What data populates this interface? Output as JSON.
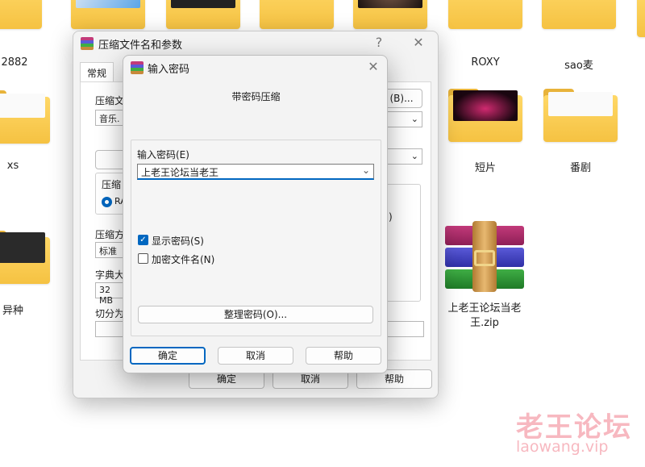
{
  "desktop": {
    "top_labels": [
      "2882",
      "ROXY",
      "sao麦"
    ],
    "middle_labels": [
      "xs",
      "短片",
      "番剧"
    ],
    "bottom_labels": [
      "异种"
    ],
    "zip_file_label": "上老王论坛当老王.zip"
  },
  "back_dialog": {
    "title": "压缩文件名和参数",
    "help_glyph": "?",
    "close_glyph": "✕",
    "tab_general": "常规",
    "archive_name_label": "压缩文",
    "archive_name_value": "音乐.",
    "browse_button": "(B)...",
    "format_label": "压缩",
    "format_option": "RA",
    "method_label": "压缩方",
    "method_value": "标准",
    "dict_label": "字典大",
    "dict_value": "32 MB",
    "split_label": "切分为",
    "right_paren": ")",
    "ok_button": "确定",
    "cancel_button": "取消",
    "help_button": "帮助"
  },
  "password_dialog": {
    "title": "输入密码",
    "close_glyph": "✕",
    "heading": "带密码压缩",
    "password_label": "输入密码(E)",
    "password_value": "上老王论坛当老王",
    "show_password_label": "显示密码(S)",
    "show_password_checked": true,
    "encrypt_names_label": "加密文件名(N)",
    "encrypt_names_checked": false,
    "organize_button": "整理密码(O)...",
    "ok_button": "确定",
    "cancel_button": "取消",
    "help_button": "帮助"
  },
  "watermark": {
    "text": "老王论坛",
    "url": "laowang.vip"
  },
  "colors": {
    "accent": "#0067c0",
    "folder": "#f5c242",
    "watermark": "#f7b8c0"
  }
}
